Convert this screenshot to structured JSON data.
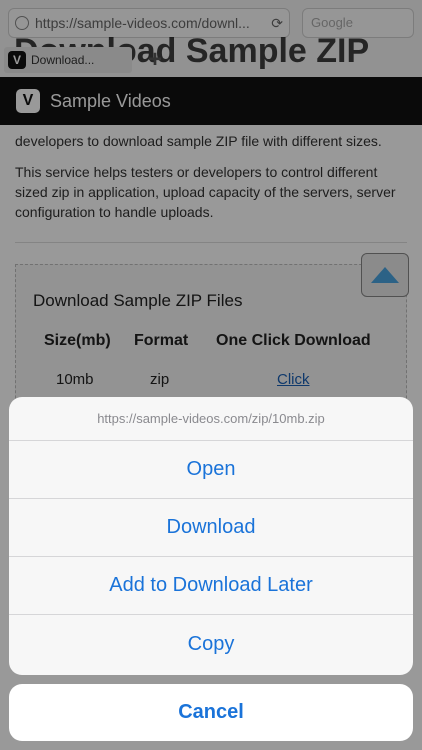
{
  "browser": {
    "url": "https://sample-videos.com/downl...",
    "search_placeholder": "Google",
    "tab_label": "Download...",
    "tab_favicon": "V",
    "new_tab": "+"
  },
  "page": {
    "heading": "Download Sample ZIP",
    "site_logo": "V",
    "site_title": "Sample Videos",
    "intro_line": "developers to download sample ZIP file with different sizes.",
    "intro_paragraph": "This service helps testers or developers to control different sized zip in application, upload capacity of the servers, server configuration to handle uploads.",
    "download_box": {
      "title": "Download Sample ZIP Files",
      "headers": [
        "Size(mb)",
        "Format",
        "One Click Download"
      ],
      "row": {
        "size": "10mb",
        "format": "zip",
        "link": "Click"
      }
    }
  },
  "action_sheet": {
    "title": "https://sample-videos.com/zip/10mb.zip",
    "items": [
      "Open",
      "Download",
      "Add to Download Later",
      "Copy"
    ],
    "cancel": "Cancel"
  },
  "colors": {
    "accent": "#1a73d9",
    "overlay": "rgba(0,0,0,0.4)"
  }
}
